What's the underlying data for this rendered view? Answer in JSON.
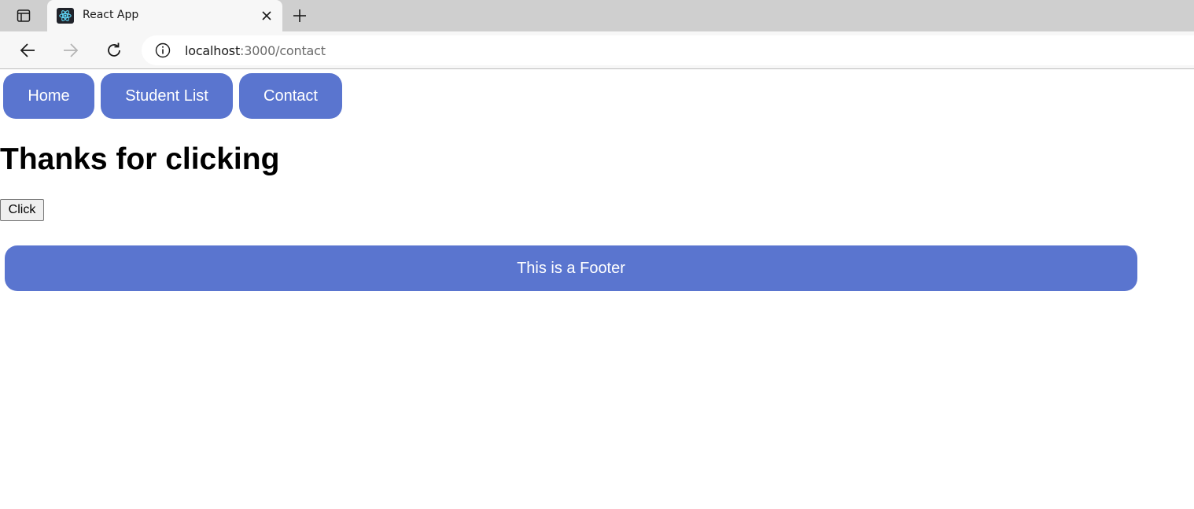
{
  "browser": {
    "tab": {
      "title": "React App",
      "favicon": "react-atom-icon"
    },
    "address": {
      "host": "localhost",
      "path": ":3000/contact"
    }
  },
  "nav": {
    "links": [
      {
        "label": "Home"
      },
      {
        "label": "Student List"
      },
      {
        "label": "Contact"
      }
    ]
  },
  "main": {
    "heading": "Thanks for clicking",
    "button_label": "Click"
  },
  "footer": {
    "text": "This is a Footer"
  },
  "colors": {
    "accent": "#5a75cf",
    "chrome_tabbar": "#cfcfcf",
    "chrome_toolbar": "#f7f7f7"
  }
}
